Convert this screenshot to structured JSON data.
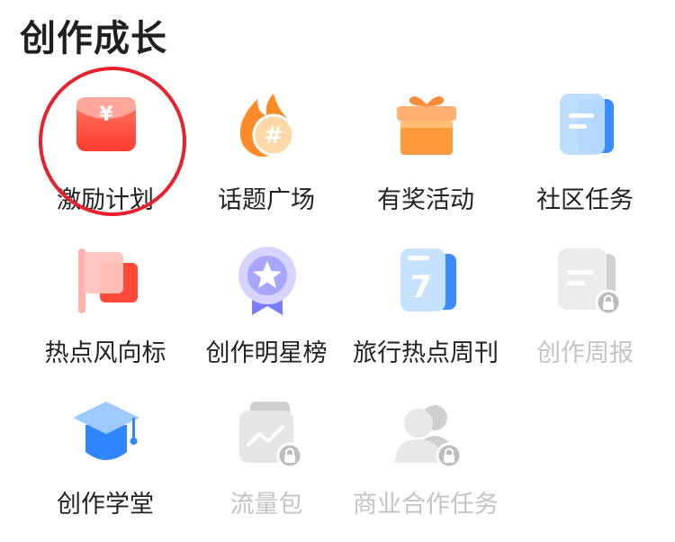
{
  "section": {
    "title": "创作成长"
  },
  "items": [
    {
      "label": "激励计划",
      "icon": "red-envelope-icon",
      "enabled": true
    },
    {
      "label": "话题广场",
      "icon": "hashtag-flame-icon",
      "enabled": true
    },
    {
      "label": "有奖活动",
      "icon": "gift-box-icon",
      "enabled": true
    },
    {
      "label": "社区任务",
      "icon": "task-card-icon",
      "enabled": true
    },
    {
      "label": "热点风向标",
      "icon": "flag-icon",
      "enabled": true
    },
    {
      "label": "创作明星榜",
      "icon": "star-medal-icon",
      "enabled": true
    },
    {
      "label": "旅行热点周刊",
      "icon": "calendar-7-icon",
      "enabled": true
    },
    {
      "label": "创作周报",
      "icon": "locked-report-icon",
      "enabled": false
    },
    {
      "label": "创作学堂",
      "icon": "graduation-cap-icon",
      "enabled": true
    },
    {
      "label": "流量包",
      "icon": "locked-wallet-icon",
      "enabled": false
    },
    {
      "label": "商业合作任务",
      "icon": "locked-users-icon",
      "enabled": false
    }
  ],
  "glyphs": {
    "yuan": "¥",
    "hash": "#",
    "seven": "7"
  },
  "colors": {
    "highlight_circle": "#e8212e",
    "disabled_text": "#c4c4c4"
  }
}
